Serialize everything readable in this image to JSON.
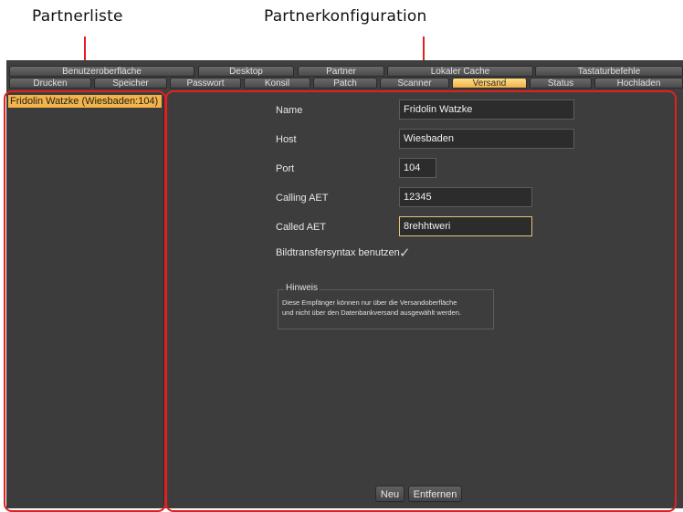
{
  "callouts": {
    "partner_list": "Partnerliste",
    "partner_config": "Partnerkonfiguration"
  },
  "tabs_row1": [
    "Benutzeroberfläche",
    "Desktop",
    "Partner",
    "Lokaler Cache",
    "Tastaturbefehle"
  ],
  "tabs_row2": [
    "Drucken",
    "Speicher",
    "Passwort",
    "Konsil",
    "Patch",
    "Scanner",
    "Versand",
    "Status",
    "Hochladen"
  ],
  "active_tab": "Versand",
  "partner_list": {
    "items": [
      "Fridolin Watzke (Wiesbaden:104)"
    ]
  },
  "form": {
    "name": {
      "label": "Name",
      "value": "Fridolin Watzke"
    },
    "host": {
      "label": "Host",
      "value": "Wiesbaden"
    },
    "port": {
      "label": "Port",
      "value": "104"
    },
    "calling_aet": {
      "label": "Calling AET",
      "value": "12345"
    },
    "called_aet": {
      "label": "Called AET",
      "value": "8rehhtweri"
    },
    "transfer_syntax": {
      "label": "Bildtransfersyntax benutzen",
      "checked": true,
      "check_glyph": "✓"
    }
  },
  "hint": {
    "title": "Hinweis",
    "line1": "Diese Empfänger können nur über die Versandoberfläche",
    "line2": "und nicht über den Datenbankversand ausgewählt werden."
  },
  "buttons": {
    "new": "Neu",
    "remove": "Entfernen"
  },
  "colors": {
    "annotation": "#e32020",
    "active_tab": "#f0b048",
    "selection": "#f3b449"
  }
}
